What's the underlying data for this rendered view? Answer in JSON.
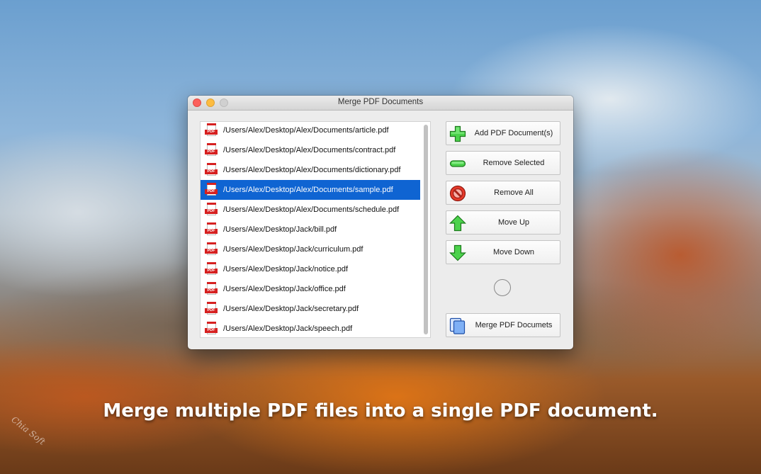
{
  "window": {
    "title": "Merge PDF Documents"
  },
  "file_list": {
    "items": [
      {
        "path": "/Users/Alex/Desktop/Alex/Documents/article.pdf",
        "selected": false
      },
      {
        "path": "/Users/Alex/Desktop/Alex/Documents/contract.pdf",
        "selected": false
      },
      {
        "path": "/Users/Alex/Desktop/Alex/Documents/dictionary.pdf",
        "selected": false
      },
      {
        "path": "/Users/Alex/Desktop/Alex/Documents/sample.pdf",
        "selected": true
      },
      {
        "path": "/Users/Alex/Desktop/Alex/Documents/schedule.pdf",
        "selected": false
      },
      {
        "path": "/Users/Alex/Desktop/Jack/bill.pdf",
        "selected": false
      },
      {
        "path": "/Users/Alex/Desktop/Jack/curriculum.pdf",
        "selected": false
      },
      {
        "path": "/Users/Alex/Desktop/Jack/notice.pdf",
        "selected": false
      },
      {
        "path": "/Users/Alex/Desktop/Jack/office.pdf",
        "selected": false
      },
      {
        "path": "/Users/Alex/Desktop/Jack/secretary.pdf",
        "selected": false
      },
      {
        "path": "/Users/Alex/Desktop/Jack/speech.pdf",
        "selected": false
      }
    ],
    "file_icon": "pdf-file-icon",
    "file_icon_text": "PDF",
    "selection_color": "#0f64d2"
  },
  "buttons": {
    "add": {
      "label": "Add PDF Document(s)",
      "icon": "green-plus-icon"
    },
    "remove_selected": {
      "label": "Remove Selected",
      "icon": "green-minus-icon"
    },
    "remove_all": {
      "label": "Remove All",
      "icon": "red-prohibited-icon"
    },
    "move_up": {
      "label": "Move Up",
      "icon": "green-up-arrow-icon"
    },
    "move_down": {
      "label": "Move Down",
      "icon": "green-down-arrow-icon"
    },
    "merge": {
      "label": "Merge PDF Documets",
      "icon": "documents-stack-icon"
    }
  },
  "caption": "Merge multiple PDF files into a single PDF document.",
  "watermark": "Chia Soft"
}
